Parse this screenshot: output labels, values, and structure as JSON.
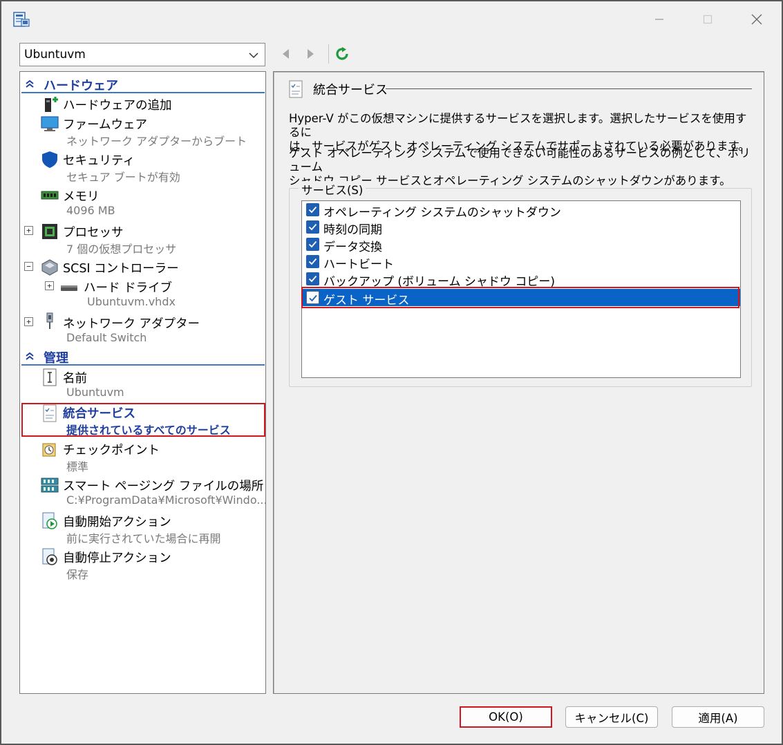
{
  "window": {
    "title": "",
    "minimize_icon": "minimize-icon",
    "maximize_icon": "maximize-icon",
    "close_icon": "close-icon"
  },
  "vm_selector": {
    "value": "Ubuntuvm"
  },
  "tree": {
    "hardware_header": "ハードウェア",
    "management_header": "管理",
    "hardware_items": [
      {
        "title": "ハードウェアの追加",
        "sub": "",
        "icon": "add-hardware-icon"
      },
      {
        "title": "ファームウェア",
        "sub": "ネットワーク アダプターからブート",
        "icon": "firmware-monitor-icon"
      },
      {
        "title": "セキュリティ",
        "sub": "セキュア ブートが有効",
        "icon": "shield-icon"
      },
      {
        "title": "メモリ",
        "sub": "4096 MB",
        "icon": "memory-icon"
      },
      {
        "title": "プロセッサ",
        "sub": "7 個の仮想プロセッサ",
        "icon": "processor-icon"
      },
      {
        "title": "SCSI コントローラー",
        "sub": "",
        "icon": "scsi-controller-icon"
      },
      {
        "title": "ハード ドライブ",
        "sub": "Ubuntuvm.vhdx",
        "icon": "hard-drive-icon"
      },
      {
        "title": "ネットワーク アダプター",
        "sub": "Default Switch",
        "icon": "network-adapter-icon"
      }
    ],
    "management_items": [
      {
        "title": "名前",
        "sub": "Ubuntuvm",
        "icon": "name-icon"
      },
      {
        "title": "統合サービス",
        "sub": "提供されているすべてのサービス",
        "icon": "integration-services-icon"
      },
      {
        "title": "チェックポイント",
        "sub": "標準",
        "icon": "checkpoint-icon"
      },
      {
        "title": "スマート ページング ファイルの場所",
        "sub": "C:¥ProgramData¥Microsoft¥Windo...",
        "icon": "smart-paging-icon"
      },
      {
        "title": "自動開始アクション",
        "sub": "前に実行されていた場合に再開",
        "icon": "auto-start-icon"
      },
      {
        "title": "自動停止アクション",
        "sub": "保存",
        "icon": "auto-stop-icon"
      }
    ]
  },
  "detail": {
    "title": "統合サービス",
    "desc1_line1": "Hyper-V がこの仮想マシンに提供するサービスを選択します。選択したサービスを使用するに",
    "desc1_line2": "は、サービスがゲスト オペレーティング システムでサポートされている必要があります。",
    "desc2_line1": "ゲスト オペレーティング システムで使用できない可能性のあるサービスの例として、ボリューム",
    "desc2_line2": "シャドウ コピー サービスとオペレーティング システムのシャットダウンがあります。",
    "services_label": "サービス(S)",
    "services": [
      {
        "label": "オペレーティング システムのシャットダウン",
        "checked": true
      },
      {
        "label": "時刻の同期",
        "checked": true
      },
      {
        "label": "データ交換",
        "checked": true
      },
      {
        "label": "ハートビート",
        "checked": true
      },
      {
        "label": "バックアップ (ボリューム シャドウ コピー)",
        "checked": true
      },
      {
        "label": "ゲスト サービス",
        "checked": true
      }
    ]
  },
  "buttons": {
    "ok": "OK(O)",
    "cancel": "キャンセル(C)",
    "apply": "適用(A)"
  },
  "colors": {
    "accent": "#0a64c8",
    "highlight_box": "#d0161e",
    "category_text": "#1f3f9e"
  }
}
